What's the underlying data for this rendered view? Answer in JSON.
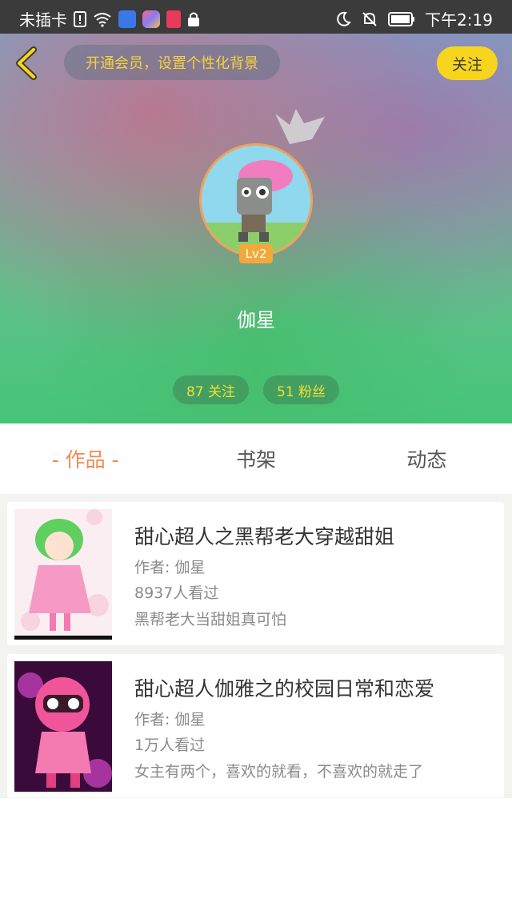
{
  "status_bar": {
    "carrier": "未插卡",
    "time": "下午2:19"
  },
  "header": {
    "vip_prompt": "开通会员，设置个性化背景",
    "follow_label": "关注",
    "level": "Lv2",
    "nickname": "伽星",
    "following": "87 关注",
    "followers": "51 粉丝"
  },
  "tabs": [
    {
      "label": "- 作品 -",
      "active": true
    },
    {
      "label": "书架",
      "active": false
    },
    {
      "label": "动态",
      "active": false
    }
  ],
  "works": [
    {
      "title": "甜心超人之黑帮老大穿越甜姐",
      "author": "作者: 伽星",
      "views": "8937人看过",
      "intro": "黑帮老大当甜姐真可怕"
    },
    {
      "title": "甜心超人伽雅之的校园日常和恋爱",
      "author": "作者: 伽星",
      "views": "1万人看过",
      "intro": "女主有两个，喜欢的就看，不喜欢的就走了"
    }
  ],
  "colors": {
    "accent_orange": "#ef8a53",
    "follow_yellow": "#f7d51e",
    "stat_text": "#f4dd33"
  }
}
